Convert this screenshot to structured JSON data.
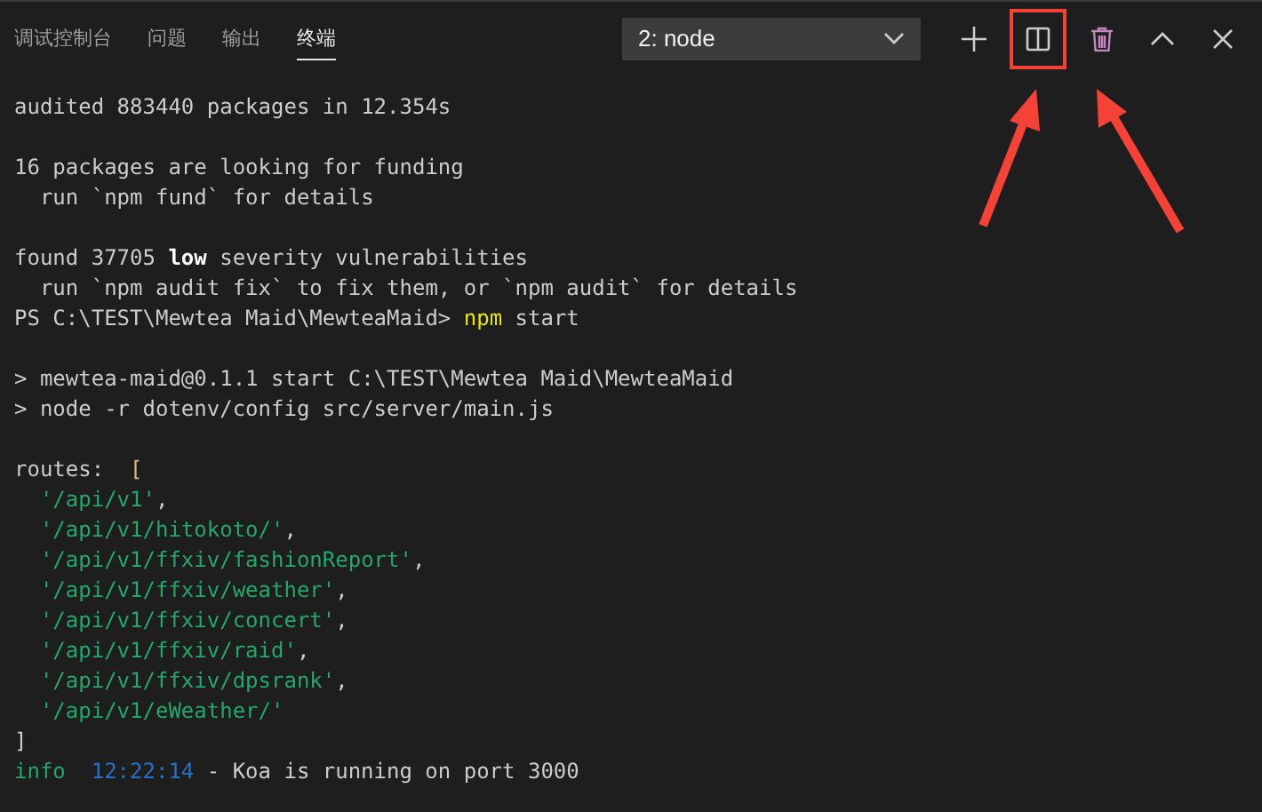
{
  "panel_tabs": [
    {
      "label": "调试控制台",
      "selected": false
    },
    {
      "label": "问题",
      "selected": false
    },
    {
      "label": "输出",
      "selected": false
    },
    {
      "label": "终端",
      "selected": true
    }
  ],
  "terminal_select": {
    "value": "2: node"
  },
  "toolbar_actions": [
    {
      "kind": "add",
      "highlighted": false
    },
    {
      "kind": "split",
      "highlighted": true
    },
    {
      "kind": "delete",
      "highlighted": false
    },
    {
      "kind": "maximize",
      "highlighted": false
    },
    {
      "kind": "close",
      "highlighted": false
    }
  ],
  "terminal": {
    "blocks": [
      [
        [
          {
            "text": "audited 883440 packages in 12.354s",
            "kind": "plain"
          }
        ]
      ],
      [
        [
          {
            "text": "16 packages are looking for funding",
            "kind": "plain"
          }
        ],
        [
          {
            "text": "  run `npm fund` for details",
            "kind": "plain"
          }
        ]
      ],
      [
        [
          {
            "text": "found 37705 ",
            "kind": "plain"
          },
          {
            "text": "low",
            "kind": "bold"
          },
          {
            "text": " severity vulnerabilities",
            "kind": "plain"
          }
        ],
        [
          {
            "text": "  run `npm audit fix` to fix them, or `npm audit` for details",
            "kind": "plain"
          }
        ],
        [
          {
            "text": "PS C:\\TEST\\Mewtea Maid\\MewteaMaid> ",
            "kind": "plain"
          },
          {
            "text": "npm",
            "kind": "command"
          },
          {
            "text": " start",
            "kind": "plain"
          }
        ]
      ],
      [
        [
          {
            "text": "> mewtea-maid@0.1.1 start C:\\TEST\\Mewtea Maid\\MewteaMaid",
            "kind": "plain"
          }
        ],
        [
          {
            "text": "> node -r dotenv/config src/server/main.js",
            "kind": "plain"
          }
        ]
      ],
      [
        [
          {
            "text": "routes:  ",
            "kind": "plain"
          },
          {
            "text": "[",
            "kind": "bracket"
          }
        ],
        [
          {
            "text": "  '/api/v1'",
            "kind": "string"
          },
          {
            "text": ",",
            "kind": "plain"
          }
        ],
        [
          {
            "text": "  '/api/v1/hitokoto/'",
            "kind": "string"
          },
          {
            "text": ",",
            "kind": "plain"
          }
        ],
        [
          {
            "text": "  '/api/v1/ffxiv/fashionReport'",
            "kind": "string"
          },
          {
            "text": ",",
            "kind": "plain"
          }
        ],
        [
          {
            "text": "  '/api/v1/ffxiv/weather'",
            "kind": "string"
          },
          {
            "text": ",",
            "kind": "plain"
          }
        ],
        [
          {
            "text": "  '/api/v1/ffxiv/concert'",
            "kind": "string"
          },
          {
            "text": ",",
            "kind": "plain"
          }
        ],
        [
          {
            "text": "  '/api/v1/ffxiv/raid'",
            "kind": "string"
          },
          {
            "text": ",",
            "kind": "plain"
          }
        ],
        [
          {
            "text": "  '/api/v1/ffxiv/dpsrank'",
            "kind": "string"
          },
          {
            "text": ",",
            "kind": "plain"
          }
        ],
        [
          {
            "text": "  '/api/v1/eWeather/'",
            "kind": "string"
          }
        ],
        [
          {
            "text": "]",
            "kind": "plain"
          }
        ],
        [
          {
            "text": "info",
            "kind": "level"
          },
          {
            "text": "12:22:14",
            "kind": "time"
          },
          {
            "text": " - Koa is running on port 3000",
            "kind": "plain"
          }
        ]
      ]
    ]
  }
}
